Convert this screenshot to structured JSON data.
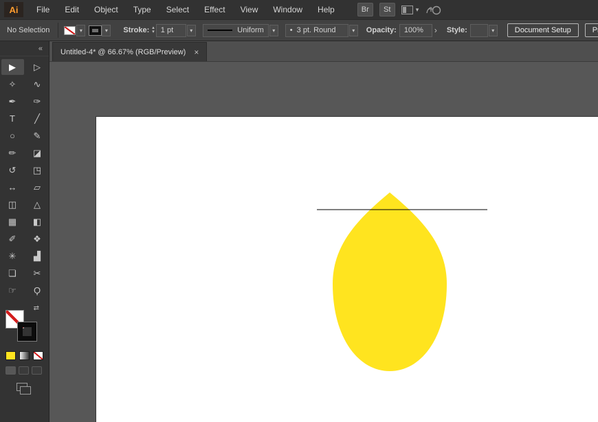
{
  "menubar": {
    "logo": "Ai",
    "items": [
      "File",
      "Edit",
      "Object",
      "Type",
      "Select",
      "Effect",
      "View",
      "Window",
      "Help"
    ],
    "bridge_button": "Br",
    "stock_button": "St"
  },
  "icons": {
    "chevron_down": "▾",
    "chevron_right": "›",
    "up": "▴",
    "down": "▾",
    "collapse": "«",
    "swap": "⇄",
    "close": "×",
    "dot": "•"
  },
  "control_bar": {
    "selection_status": "No Selection",
    "stroke_label": "Stroke:",
    "stroke_weight": "1 pt",
    "width_profile": "Uniform",
    "brush_name": "3 pt. Round",
    "opacity_label": "Opacity:",
    "opacity_value": "100%",
    "style_label": "Style:",
    "document_setup_label": "Document Setup",
    "preferences_label": "Preferences"
  },
  "document_tab": {
    "title": "Untitled-4* @ 66.67% (RGB/Preview)"
  },
  "tools": [
    {
      "name": "selection-tool",
      "glyph": "▶",
      "active": true
    },
    {
      "name": "direct-selection-tool",
      "glyph": "▷"
    },
    {
      "name": "magic-wand-tool",
      "glyph": "✧"
    },
    {
      "name": "lasso-tool",
      "glyph": "∿"
    },
    {
      "name": "pen-tool",
      "glyph": "✒"
    },
    {
      "name": "curvature-tool",
      "glyph": "✑"
    },
    {
      "name": "type-tool",
      "glyph": "T"
    },
    {
      "name": "line-segment-tool",
      "glyph": "╱"
    },
    {
      "name": "ellipse-tool",
      "glyph": "○"
    },
    {
      "name": "paintbrush-tool",
      "glyph": "✎"
    },
    {
      "name": "pencil-tool",
      "glyph": "✏"
    },
    {
      "name": "eraser-tool",
      "glyph": "◪"
    },
    {
      "name": "rotate-tool",
      "glyph": "↺"
    },
    {
      "name": "scale-tool",
      "glyph": "◳"
    },
    {
      "name": "width-tool",
      "glyph": "↔"
    },
    {
      "name": "free-transform-tool",
      "glyph": "▱"
    },
    {
      "name": "shape-builder-tool",
      "glyph": "◫"
    },
    {
      "name": "perspective-grid-tool",
      "glyph": "△"
    },
    {
      "name": "mesh-tool",
      "glyph": "▦"
    },
    {
      "name": "gradient-tool",
      "glyph": "◧"
    },
    {
      "name": "eyedropper-tool",
      "glyph": "✐"
    },
    {
      "name": "blend-tool",
      "glyph": "❖"
    },
    {
      "name": "symbol-sprayer-tool",
      "glyph": "✳"
    },
    {
      "name": "column-graph-tool",
      "glyph": "▟"
    },
    {
      "name": "artboard-tool",
      "glyph": "❏"
    },
    {
      "name": "slice-tool",
      "glyph": "✂"
    },
    {
      "name": "hand-tool",
      "glyph": "☞"
    },
    {
      "name": "zoom-tool",
      "glyph": "Ϙ"
    }
  ],
  "canvas": {
    "shape_fill": "#ffe41f",
    "line_color": "#000000"
  }
}
